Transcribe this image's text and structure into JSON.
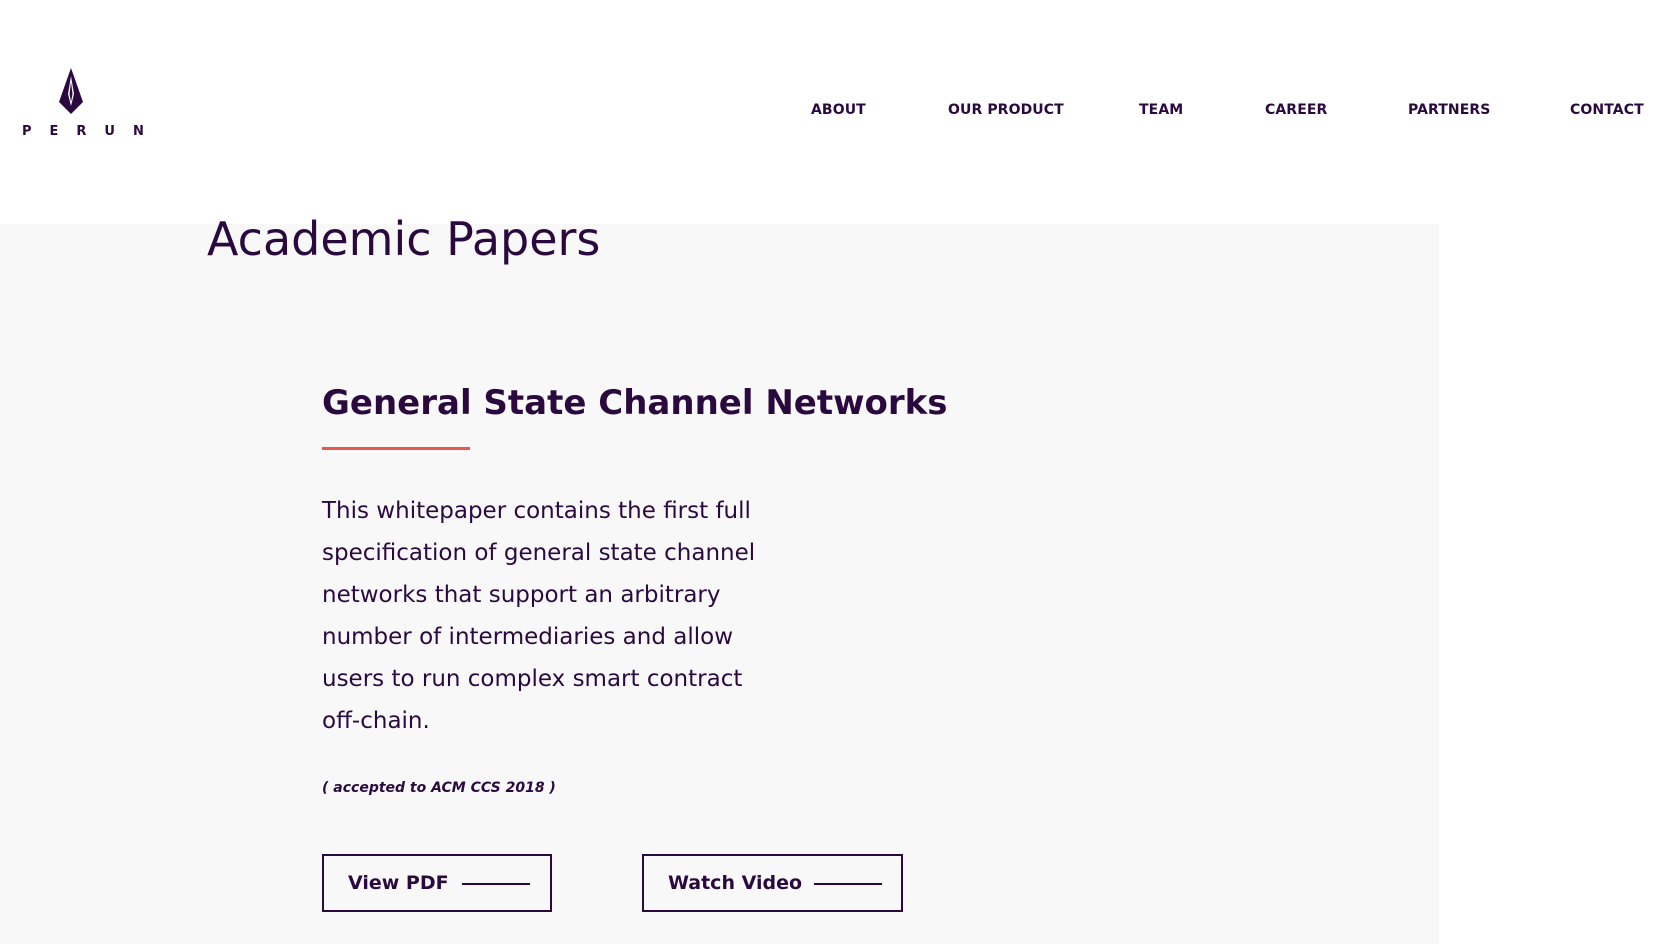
{
  "brand": {
    "name": "PERUN",
    "logo_icon": "perun-flame-icon",
    "color": "#2a0a3e",
    "accent": "#e8574e"
  },
  "nav": {
    "items": [
      {
        "label": "ABOUT"
      },
      {
        "label": "OUR PRODUCT"
      },
      {
        "label": "TEAM"
      },
      {
        "label": "CAREER"
      },
      {
        "label": "PARTNERS"
      },
      {
        "label": "CONTACT"
      }
    ]
  },
  "main": {
    "section_title": "Academic Papers",
    "paper": {
      "title": "General State Channel Networks",
      "description": "This whitepaper contains the first full specification of general state channel networks that support an arbitrary number of intermediaries and allow users to run complex smart contract off-chain.",
      "note": "( accepted to ACM CCS 2018 )",
      "buttons": {
        "pdf_label": "View PDF",
        "video_label": "Watch Video"
      }
    }
  }
}
